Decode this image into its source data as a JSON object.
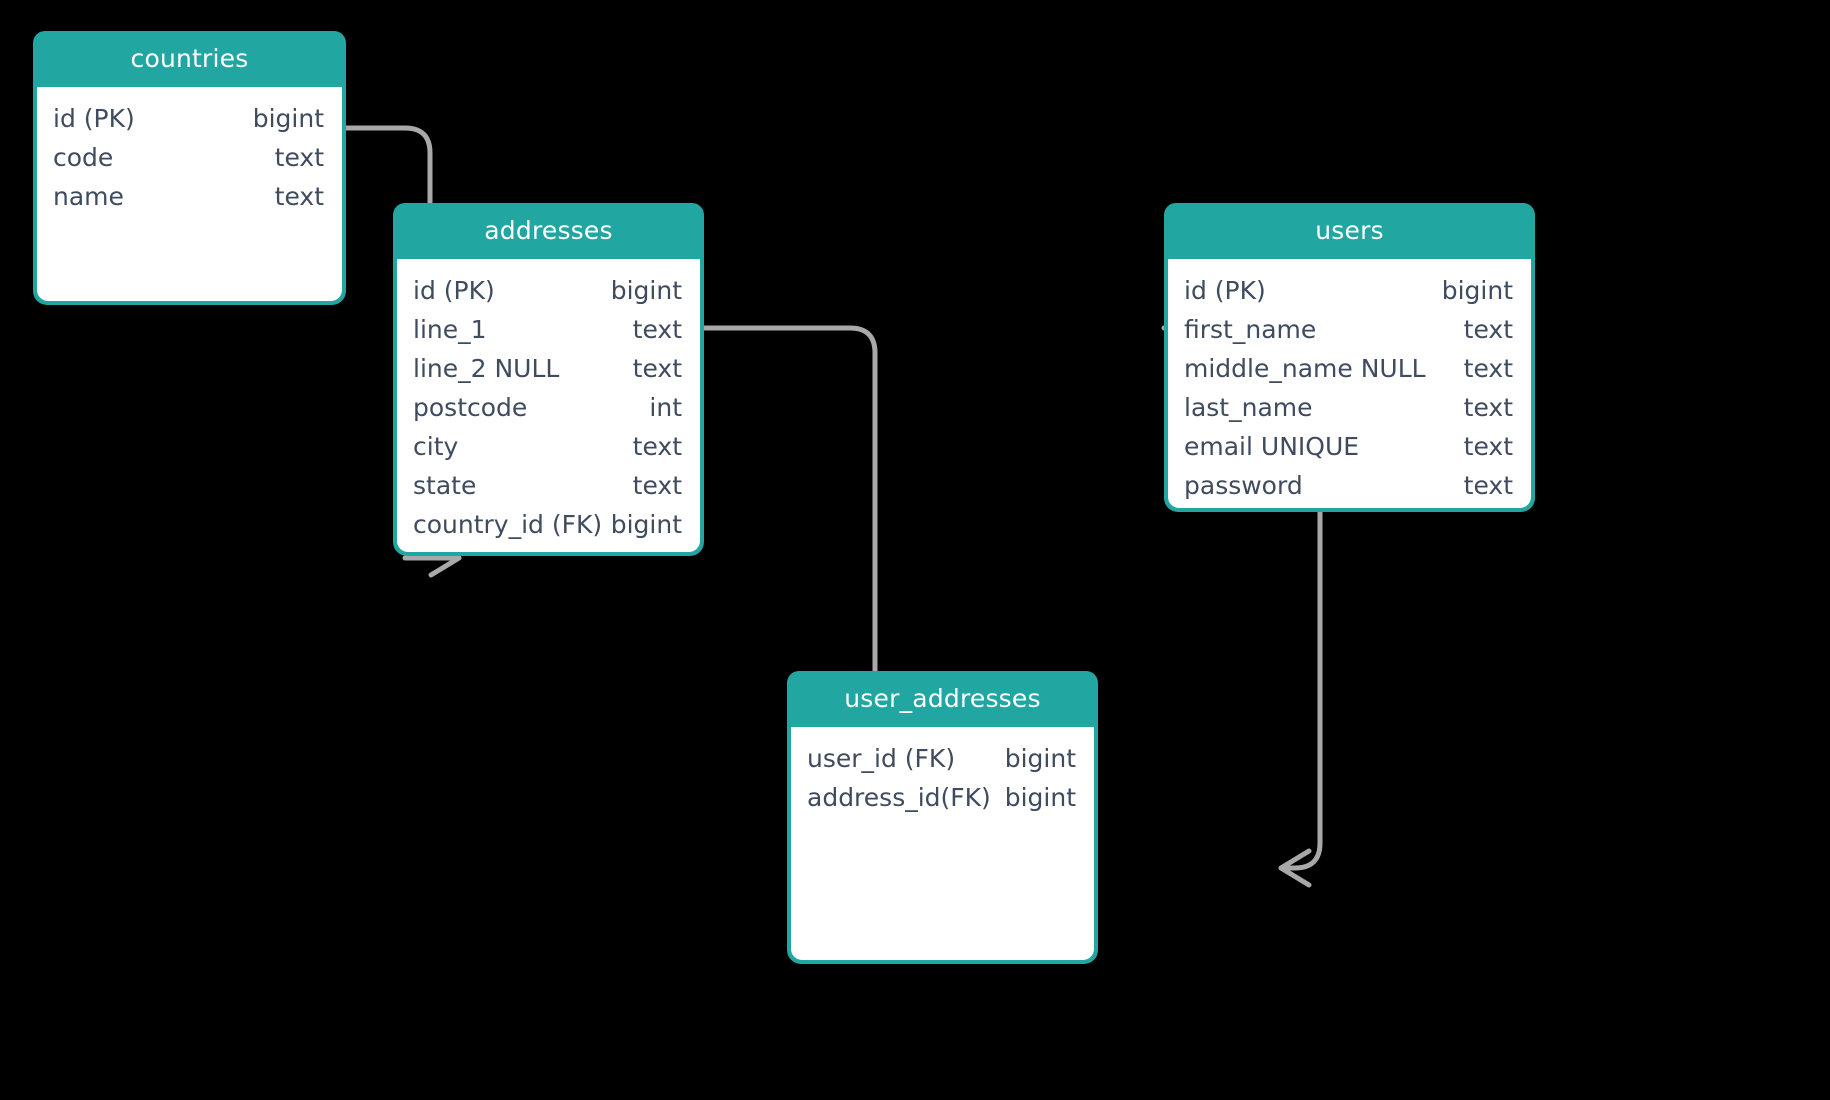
{
  "diagram": {
    "kind": "entity-relationship-diagram",
    "background_color": "#000000",
    "header_color": "#21a6a2",
    "header_text_color": "#ffffff",
    "field_text_color": "#3f4b5e",
    "body_color": "#ffffff",
    "connector_color": "#a9a9a9"
  },
  "entities": [
    {
      "id": "countries",
      "title": "countries",
      "fields": [
        {
          "name": "id (PK)",
          "type": "bigint"
        },
        {
          "name": "code",
          "type": "text"
        },
        {
          "name": "name",
          "type": "text"
        }
      ]
    },
    {
      "id": "addresses",
      "title": "addresses",
      "fields": [
        {
          "name": "id (PK)",
          "type": "bigint"
        },
        {
          "name": "line_1",
          "type": "text"
        },
        {
          "name": "line_2 NULL",
          "type": "text"
        },
        {
          "name": "postcode",
          "type": "int"
        },
        {
          "name": "city",
          "type": "text"
        },
        {
          "name": "state",
          "type": "text"
        },
        {
          "name": "country_id (FK)",
          "type": "bigint"
        }
      ]
    },
    {
      "id": "users",
      "title": "users",
      "fields": [
        {
          "name": "id (PK)",
          "type": "bigint"
        },
        {
          "name": "first_name",
          "type": "text"
        },
        {
          "name": "middle_name NULL",
          "type": "text"
        },
        {
          "name": "last_name",
          "type": "text"
        },
        {
          "name": "email UNIQUE",
          "type": "text"
        },
        {
          "name": "password",
          "type": "text"
        }
      ]
    },
    {
      "id": "user_addresses",
      "title": "user_addresses",
      "fields": [
        {
          "name": "user_id (FK)",
          "type": "bigint"
        },
        {
          "name": "address_id(FK)",
          "type": "bigint"
        }
      ]
    }
  ],
  "relationships": [
    {
      "id": "countries-addresses",
      "from_entity": "countries",
      "from_field": "id (PK)",
      "to_entity": "addresses",
      "to_field": "country_id (FK)",
      "cardinality": "one-to-many"
    },
    {
      "id": "addresses-user_addresses",
      "from_entity": "addresses",
      "from_field": "id (PK)",
      "to_entity": "user_addresses",
      "to_field": "address_id(FK)",
      "cardinality": "one-to-many"
    },
    {
      "id": "users-user_addresses",
      "from_entity": "users",
      "from_field": "id (PK)",
      "to_entity": "user_addresses",
      "to_field": "user_id (FK)",
      "cardinality": "one-to-many"
    }
  ]
}
